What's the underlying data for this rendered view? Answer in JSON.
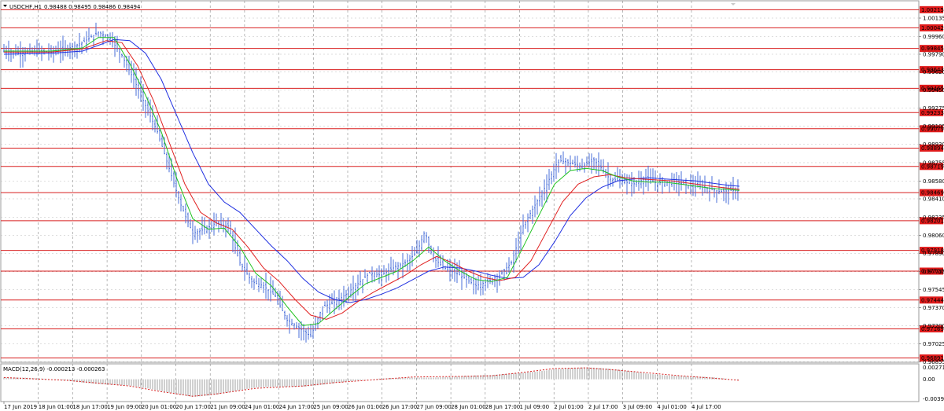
{
  "header": {
    "symbol_label": "USDCHF,H1",
    "ohlc": "0.98488 0.98495 0.98486 0.98494",
    "macd_label": "MACD(12,26,9) -0.000213 -0.000263"
  },
  "colors": {
    "background": "#ffffff",
    "candles": "#4a6fd8",
    "ma_fast": "#1fc21f",
    "ma_mid": "#e02020",
    "ma_slow": "#2030e0",
    "level_line": "#d81e1e",
    "level_tag": "#e01b1b",
    "macd_signal": "#d82020",
    "grid": "#8a8a8a"
  },
  "chart_data": {
    "type": "candlestick",
    "symbol": "USDCHF",
    "timeframe": "H1",
    "ylim": [
      0.9685,
      1.003
    ],
    "y_ticks": [
      "1.00135",
      "0.99960",
      "0.99790",
      "0.99620",
      "0.99450",
      "0.99275",
      "0.99105",
      "0.98930",
      "0.98755",
      "0.98580",
      "0.98410",
      "0.98235",
      "0.98060",
      "0.97890",
      "0.97715",
      "0.97545",
      "0.97370",
      "0.97200",
      "0.97025",
      "0.96855"
    ],
    "levels": [
      "1.00215",
      "1.00042",
      "0.99845",
      "0.99643",
      "0.99465",
      "0.99233",
      "0.99079",
      "0.98894",
      "0.98719",
      "0.98469",
      "0.98201",
      "0.97918",
      "0.97720",
      "0.97444",
      "0.97169",
      "0.96891"
    ],
    "x_labels": [
      "17 Jun 2019",
      "18 Jun 01:00",
      "18 Jun 17:00",
      "19 Jun 09:00",
      "20 Jun 01:00",
      "20 Jun 17:00",
      "21 Jun 09:00",
      "24 Jun 01:00",
      "24 Jun 17:00",
      "25 Jun 09:00",
      "26 Jun 01:00",
      "26 Jun 17:00",
      "27 Jun 09:00",
      "28 Jun 01:00",
      "28 Jun 17:00",
      "1 Jul 09:00",
      "2 Jul 01:00",
      "2 Jul 17:00",
      "3 Jul 09:00",
      "4 Jul 01:00",
      "4 Jul 17:00"
    ],
    "price_path": [
      [
        0,
        0.9982
      ],
      [
        20,
        0.998
      ],
      [
        40,
        0.9982
      ],
      [
        60,
        0.9981
      ],
      [
        80,
        0.9984
      ],
      [
        100,
        0.999
      ],
      [
        120,
        1.0
      ],
      [
        135,
        0.9994
      ],
      [
        150,
        0.9978
      ],
      [
        165,
        0.9955
      ],
      [
        180,
        0.993
      ],
      [
        195,
        0.9905
      ],
      [
        210,
        0.987
      ],
      [
        225,
        0.9835
      ],
      [
        240,
        0.9808
      ],
      [
        255,
        0.9812
      ],
      [
        270,
        0.9818
      ],
      [
        285,
        0.9815
      ],
      [
        300,
        0.978
      ],
      [
        315,
        0.9762
      ],
      [
        330,
        0.9758
      ],
      [
        345,
        0.9748
      ],
      [
        360,
        0.9725
      ],
      [
        375,
        0.9718
      ],
      [
        390,
        0.971
      ],
      [
        405,
        0.9738
      ],
      [
        420,
        0.9742
      ],
      [
        435,
        0.975
      ],
      [
        450,
        0.976
      ],
      [
        465,
        0.977
      ],
      [
        480,
        0.9768
      ],
      [
        495,
        0.9775
      ],
      [
        510,
        0.978
      ],
      [
        525,
        0.979
      ],
      [
        535,
        0.981
      ],
      [
        545,
        0.9785
      ],
      [
        560,
        0.9775
      ],
      [
        580,
        0.9768
      ],
      [
        600,
        0.9758
      ],
      [
        615,
        0.9762
      ],
      [
        630,
        0.9768
      ],
      [
        645,
        0.978
      ],
      [
        660,
        0.9815
      ],
      [
        675,
        0.9835
      ],
      [
        690,
        0.9855
      ],
      [
        705,
        0.9878
      ],
      [
        720,
        0.9875
      ],
      [
        735,
        0.9872
      ],
      [
        750,
        0.9878
      ],
      [
        760,
        0.987
      ],
      [
        770,
        0.986
      ],
      [
        785,
        0.9858
      ],
      [
        800,
        0.9855
      ],
      [
        815,
        0.986
      ],
      [
        830,
        0.9856
      ],
      [
        850,
        0.9858
      ],
      [
        870,
        0.9854
      ],
      [
        890,
        0.9852
      ],
      [
        910,
        0.9848
      ],
      [
        925,
        0.9849
      ],
      [
        935,
        0.9849
      ]
    ],
    "ma_fast": [
      [
        0,
        0.9982
      ],
      [
        60,
        0.9982
      ],
      [
        100,
        0.9985
      ],
      [
        120,
        0.9995
      ],
      [
        140,
        0.9995
      ],
      [
        160,
        0.997
      ],
      [
        180,
        0.994
      ],
      [
        200,
        0.9905
      ],
      [
        220,
        0.986
      ],
      [
        240,
        0.9822
      ],
      [
        260,
        0.9812
      ],
      [
        280,
        0.9813
      ],
      [
        300,
        0.9795
      ],
      [
        320,
        0.977
      ],
      [
        340,
        0.9758
      ],
      [
        360,
        0.9738
      ],
      [
        380,
        0.972
      ],
      [
        400,
        0.9722
      ],
      [
        420,
        0.9735
      ],
      [
        440,
        0.9748
      ],
      [
        460,
        0.976
      ],
      [
        480,
        0.9766
      ],
      [
        500,
        0.9772
      ],
      [
        520,
        0.9782
      ],
      [
        540,
        0.9795
      ],
      [
        560,
        0.9782
      ],
      [
        580,
        0.9772
      ],
      [
        600,
        0.9764
      ],
      [
        620,
        0.9762
      ],
      [
        640,
        0.9766
      ],
      [
        660,
        0.9795
      ],
      [
        680,
        0.9825
      ],
      [
        700,
        0.9855
      ],
      [
        720,
        0.9868
      ],
      [
        740,
        0.987
      ],
      [
        760,
        0.9868
      ],
      [
        780,
        0.9862
      ],
      [
        800,
        0.9858
      ],
      [
        820,
        0.9857
      ],
      [
        840,
        0.9857
      ],
      [
        860,
        0.9855
      ],
      [
        880,
        0.9853
      ],
      [
        900,
        0.9851
      ],
      [
        920,
        0.985
      ],
      [
        935,
        0.9849
      ]
    ],
    "ma_mid": [
      [
        0,
        0.9981
      ],
      [
        60,
        0.9981
      ],
      [
        100,
        0.9984
      ],
      [
        130,
        0.9992
      ],
      [
        150,
        0.999
      ],
      [
        170,
        0.9968
      ],
      [
        190,
        0.9935
      ],
      [
        210,
        0.9895
      ],
      [
        230,
        0.9855
      ],
      [
        250,
        0.9828
      ],
      [
        270,
        0.9818
      ],
      [
        290,
        0.9812
      ],
      [
        310,
        0.9795
      ],
      [
        330,
        0.9775
      ],
      [
        350,
        0.9762
      ],
      [
        370,
        0.9745
      ],
      [
        390,
        0.973
      ],
      [
        410,
        0.9726
      ],
      [
        430,
        0.9732
      ],
      [
        450,
        0.9743
      ],
      [
        470,
        0.9752
      ],
      [
        490,
        0.976
      ],
      [
        510,
        0.9768
      ],
      [
        530,
        0.9778
      ],
      [
        550,
        0.9786
      ],
      [
        570,
        0.978
      ],
      [
        590,
        0.9772
      ],
      [
        610,
        0.9766
      ],
      [
        630,
        0.9763
      ],
      [
        650,
        0.9766
      ],
      [
        670,
        0.9782
      ],
      [
        690,
        0.981
      ],
      [
        710,
        0.9838
      ],
      [
        730,
        0.9855
      ],
      [
        750,
        0.9862
      ],
      [
        770,
        0.9864
      ],
      [
        790,
        0.9861
      ],
      [
        810,
        0.986
      ],
      [
        830,
        0.9859
      ],
      [
        850,
        0.9858
      ],
      [
        870,
        0.9856
      ],
      [
        890,
        0.9854
      ],
      [
        910,
        0.9852
      ],
      [
        935,
        0.985
      ]
    ],
    "ma_slow": [
      [
        0,
        0.9979
      ],
      [
        60,
        0.998
      ],
      [
        100,
        0.9982
      ],
      [
        140,
        0.9993
      ],
      [
        160,
        0.9992
      ],
      [
        180,
        0.998
      ],
      [
        200,
        0.9955
      ],
      [
        220,
        0.992
      ],
      [
        240,
        0.9885
      ],
      [
        260,
        0.9855
      ],
      [
        280,
        0.9838
      ],
      [
        300,
        0.9828
      ],
      [
        320,
        0.9812
      ],
      [
        340,
        0.9796
      ],
      [
        360,
        0.9782
      ],
      [
        380,
        0.9765
      ],
      [
        400,
        0.9752
      ],
      [
        420,
        0.9745
      ],
      [
        440,
        0.9742
      ],
      [
        460,
        0.9745
      ],
      [
        480,
        0.975
      ],
      [
        500,
        0.9756
      ],
      [
        520,
        0.9764
      ],
      [
        540,
        0.9772
      ],
      [
        560,
        0.9776
      ],
      [
        580,
        0.9775
      ],
      [
        600,
        0.9772
      ],
      [
        620,
        0.9768
      ],
      [
        640,
        0.9765
      ],
      [
        660,
        0.9766
      ],
      [
        680,
        0.9778
      ],
      [
        700,
        0.98
      ],
      [
        720,
        0.9825
      ],
      [
        740,
        0.9842
      ],
      [
        760,
        0.9852
      ],
      [
        780,
        0.9858
      ],
      [
        800,
        0.986
      ],
      [
        820,
        0.9861
      ],
      [
        840,
        0.986
      ],
      [
        860,
        0.9859
      ],
      [
        880,
        0.9858
      ],
      [
        900,
        0.9856
      ],
      [
        920,
        0.9854
      ],
      [
        935,
        0.9853
      ]
    ],
    "macd": {
      "y_ticks": [
        "0.002712",
        "0.00",
        "-0.003939"
      ],
      "signal_path": [
        [
          0,
          0.0003
        ],
        [
          80,
          -0.0002
        ],
        [
          160,
          -0.0012
        ],
        [
          200,
          -0.0022
        ],
        [
          240,
          -0.003
        ],
        [
          270,
          -0.0026
        ],
        [
          320,
          -0.0016
        ],
        [
          380,
          -0.0012
        ],
        [
          420,
          -0.0006
        ],
        [
          480,
          0.0
        ],
        [
          520,
          0.0004
        ],
        [
          580,
          0.0005
        ],
        [
          620,
          0.0006
        ],
        [
          660,
          0.0012
        ],
        [
          700,
          0.0019
        ],
        [
          740,
          0.002
        ],
        [
          780,
          0.0016
        ],
        [
          820,
          0.0011
        ],
        [
          860,
          0.0006
        ],
        [
          900,
          0.0002
        ],
        [
          935,
          -0.0002
        ]
      ]
    }
  }
}
